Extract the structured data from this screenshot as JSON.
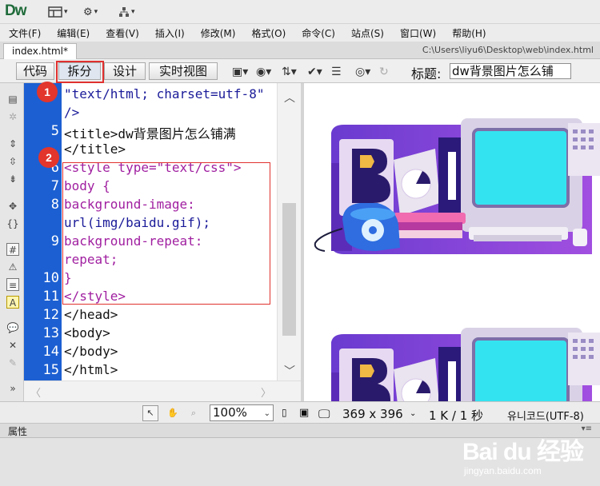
{
  "app": {
    "logo": "Dw",
    "top_icons": [
      "layout-icon",
      "gear-icon",
      "site-icon"
    ]
  },
  "menu": [
    "文件(F)",
    "编辑(E)",
    "查看(V)",
    "插入(I)",
    "修改(M)",
    "格式(O)",
    "命令(C)",
    "站点(S)",
    "窗口(W)",
    "帮助(H)"
  ],
  "document": {
    "tab_label": "index.html*",
    "path": "C:\\Users\\liyu6\\Desktop\\web\\index.html"
  },
  "toolbar": {
    "view_code": "代码",
    "view_split": "拆分",
    "view_design": "设计",
    "view_live": "实时视图",
    "title_label": "标题:",
    "title_value": "dw背景图片怎么铺"
  },
  "code": {
    "line_numbers": [
      "",
      "",
      "5",
      "",
      "6",
      "7",
      "8",
      "",
      "9",
      "",
      "10",
      "11",
      "12",
      "13",
      "14",
      "15"
    ],
    "lines": [
      {
        "text": "\"text/html; charset=utf-8\"",
        "color": "#1a1a99"
      },
      {
        "text": " />",
        "color": "#1a1a99"
      },
      {
        "text": "<title>dw背景图片怎么铺满",
        "color": "#111111"
      },
      {
        "text": "</title>",
        "color": "#111111"
      },
      {
        "text": "<style type=\"text/css\">",
        "color": "#a01fa0"
      },
      {
        "text": "body {",
        "color": "#a01fa0"
      },
      {
        "text": "    background-image:",
        "color": "#a01fa0"
      },
      {
        "text": "url(img/baidu.gif);",
        "color": "#1a1a99"
      },
      {
        "text": "    background-repeat:",
        "color": "#a01fa0"
      },
      {
        "text": "repeat;",
        "color": "#a01fa0"
      },
      {
        "text": "}",
        "color": "#a01fa0"
      },
      {
        "text": "</style>",
        "color": "#a01fa0"
      },
      {
        "text": "</head>",
        "color": "#111111"
      },
      {
        "text": "<body>",
        "color": "#111111"
      },
      {
        "text": "</body>",
        "color": "#111111"
      },
      {
        "text": "</html>",
        "color": "#111111"
      }
    ]
  },
  "annotations": {
    "badge1": "1",
    "badge2": "2",
    "highlight_color": "#e0312f"
  },
  "status": {
    "zoom": "100%",
    "dimensions": "369 x 396",
    "filesize": "1 K / 1 秒",
    "encoding": "유니코드(UTF-8)"
  },
  "panel": {
    "title": "属性"
  },
  "watermark": {
    "main": "Bai du 经验",
    "sub": "jingyan.baidu.com"
  },
  "colors": {
    "gutter": "#1c5fd2",
    "tag": "#a01fa0",
    "string": "#1a1a99",
    "accent_red": "#e0312f"
  }
}
